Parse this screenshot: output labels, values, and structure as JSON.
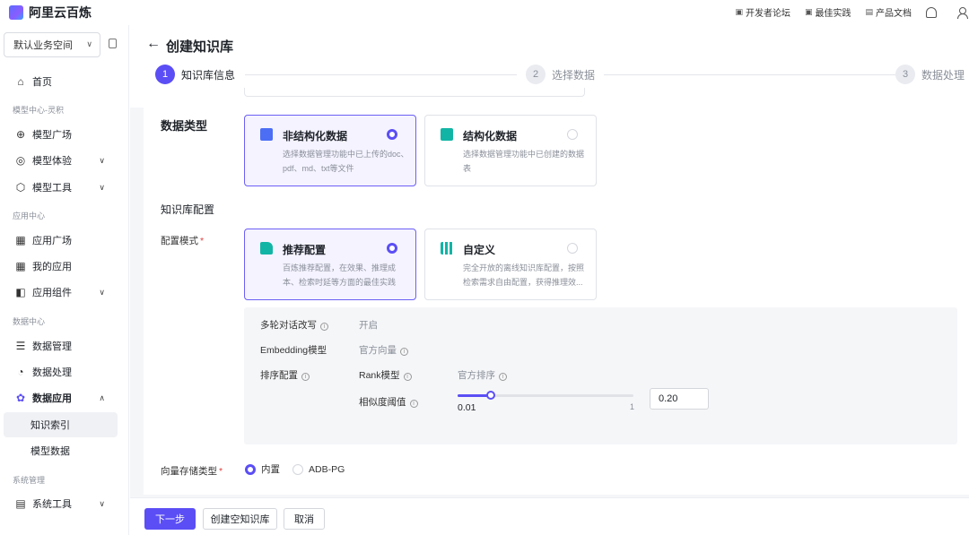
{
  "header": {
    "logo_text": "阿里云百炼",
    "links": [
      {
        "icon": "forum-icon",
        "label": "开发者论坛"
      },
      {
        "icon": "practice-icon",
        "label": "最佳实践"
      },
      {
        "icon": "doc-icon",
        "label": "产品文档"
      }
    ]
  },
  "sidebar": {
    "workspace": "默认业务空间",
    "home": "首页",
    "sections": {
      "model": "模型中心-灵积",
      "app": "应用中心",
      "data": "数据中心",
      "system": "系统管理"
    },
    "items": {
      "model_square": "模型广场",
      "model_experience": "模型体验",
      "model_tools": "模型工具",
      "app_square": "应用广场",
      "my_apps": "我的应用",
      "app_components": "应用组件",
      "data_mgmt": "数据管理",
      "data_processing": "数据处理",
      "data_apps": "数据应用",
      "knowledge_index": "知识索引",
      "model_data": "模型数据",
      "system_tools": "系统工具"
    }
  },
  "page": {
    "title": "创建知识库",
    "steps": [
      {
        "num": "1",
        "label": "知识库信息"
      },
      {
        "num": "2",
        "label": "选择数据"
      },
      {
        "num": "3",
        "label": "数据处理"
      }
    ]
  },
  "form": {
    "data_type_label": "数据类型",
    "data_type_options": [
      {
        "title": "非结构化数据",
        "desc": "选择数据管理功能中已上传的doc、pdf、md、txt等文件",
        "selected": true
      },
      {
        "title": "结构化数据",
        "desc": "选择数据管理功能中已创建的数据表",
        "selected": false
      }
    ],
    "kb_config_label": "知识库配置",
    "config_mode_label": "配置模式",
    "config_mode_options": [
      {
        "title": "推荐配置",
        "desc": "百炼推荐配置，在效果、推理成本、检索时延等方面的最佳实践",
        "selected": true
      },
      {
        "title": "自定义",
        "desc": "完全开放的离线知识库配置，按照检索需求自由配置，获得推理效...",
        "selected": false
      }
    ],
    "config": {
      "multi_turn_label": "多轮对话改写",
      "multi_turn_value": "开启",
      "embedding_label": "Embedding模型",
      "embedding_value": "官方向量",
      "ranking_label": "排序配置",
      "rank_model_label": "Rank模型",
      "rank_model_value": "官方排序",
      "similarity_label": "相似度阈值",
      "slider_min": "0.01",
      "slider_max": "1",
      "threshold_value": "0.20",
      "threshold_fraction": 0.19
    },
    "vector_store_label": "向量存储类型",
    "vector_store_options": [
      {
        "label": "内置",
        "selected": true
      },
      {
        "label": "ADB-PG",
        "selected": false
      }
    ]
  },
  "footer": {
    "next": "下一步",
    "create_empty": "创建空知识库",
    "cancel": "取消"
  },
  "colors": {
    "primary": "#5b4ef5",
    "required": "#e03e3e"
  }
}
